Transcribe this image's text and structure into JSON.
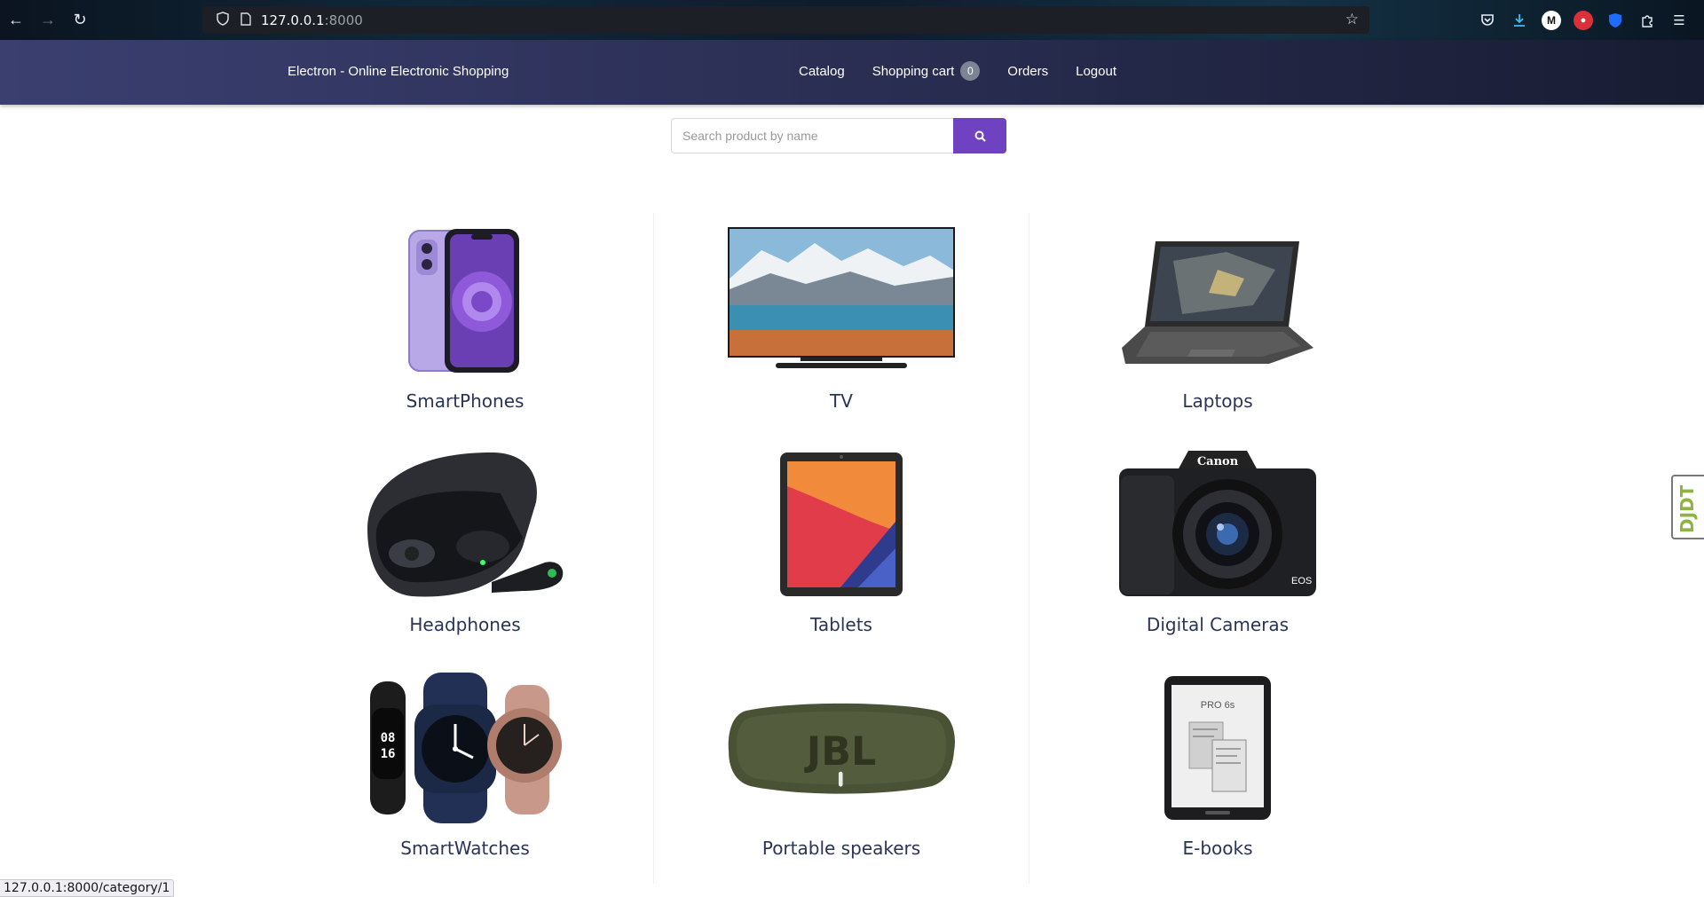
{
  "browser": {
    "url_host": "127.0.0.1",
    "url_port": ":8000",
    "status_url": "127.0.0.1:8000/category/1"
  },
  "header": {
    "brand": "Electron - Online Electronic Shopping",
    "nav": {
      "catalog": "Catalog",
      "cart": "Shopping cart",
      "cart_count": "0",
      "orders": "Orders",
      "logout": "Logout"
    }
  },
  "search": {
    "placeholder": "Search product by name"
  },
  "categories": [
    {
      "label": "SmartPhones",
      "icon": "smartphone-image"
    },
    {
      "label": "TV",
      "icon": "tv-image"
    },
    {
      "label": "Laptops",
      "icon": "laptop-image"
    },
    {
      "label": "Headphones",
      "icon": "headphones-image"
    },
    {
      "label": "Tablets",
      "icon": "tablet-image"
    },
    {
      "label": "Digital Cameras",
      "icon": "camera-image"
    },
    {
      "label": "SmartWatches",
      "icon": "smartwatch-image"
    },
    {
      "label": "Portable speakers",
      "icon": "speaker-image"
    },
    {
      "label": "E-books",
      "icon": "ebook-image"
    }
  ],
  "product_text": {
    "camera_brand": "Canon",
    "camera_model": "EOS",
    "speaker_brand": "JBL",
    "ebook_model": "PRO 6s",
    "watch_time_h": "08",
    "watch_time_m": "16"
  },
  "debug_toolbar": "DJDT",
  "colors": {
    "header_start": "#3a3f70",
    "header_end": "#181c32",
    "accent": "#6f42c1",
    "category_text": "#2a3556"
  }
}
